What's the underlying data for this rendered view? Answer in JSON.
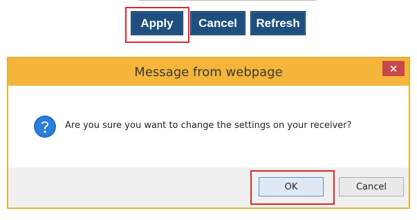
{
  "toolbar": {
    "apply_label": "Apply",
    "cancel_label": "Cancel",
    "refresh_label": "Refresh"
  },
  "dialog": {
    "title": "Message from webpage",
    "close_glyph": "×",
    "icon": "question-icon",
    "message": "Are you sure you want to change the settings on your receiver?",
    "ok_label": "OK",
    "cancel_label": "Cancel"
  },
  "colors": {
    "button_bg": "#1f4f7e",
    "titlebar": "#f4b53a",
    "close_bg": "#c7474b",
    "highlight": "#e0242a",
    "question_icon": "#1e6fc7"
  }
}
